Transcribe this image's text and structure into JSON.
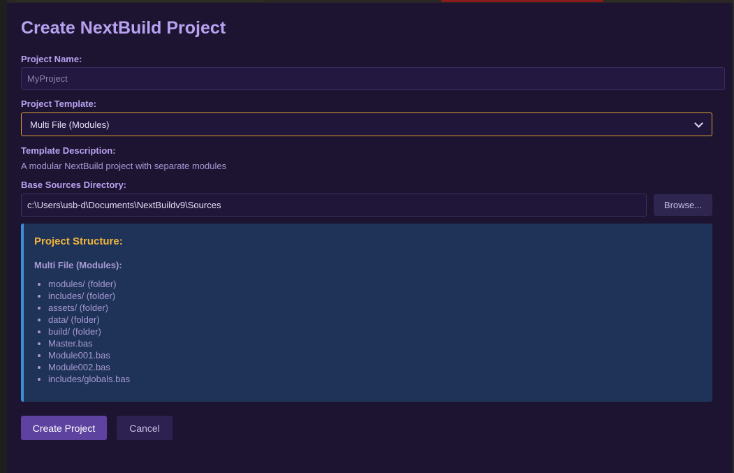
{
  "dialog": {
    "title": "Create NextBuild Project"
  },
  "project_name": {
    "label": "Project Name:",
    "placeholder": "MyProject",
    "value": ""
  },
  "project_template": {
    "label": "Project Template:",
    "selected": "Multi File (Modules)"
  },
  "template_description": {
    "label": "Template Description:",
    "text": "A modular NextBuild project with separate modules"
  },
  "base_sources": {
    "label": "Base Sources Directory:",
    "value": "c:\\Users\\usb-d\\Documents\\NextBuildv9\\Sources",
    "browse_label": "Browse..."
  },
  "structure": {
    "title": "Project Structure:",
    "subtitle": "Multi File (Modules):",
    "items": [
      "modules/ (folder)",
      "includes/ (folder)",
      "assets/ (folder)",
      "data/ (folder)",
      "build/ (folder)",
      "Master.bas",
      "Module001.bas",
      "Module002.bas",
      "includes/globals.bas"
    ]
  },
  "actions": {
    "create_label": "Create Project",
    "cancel_label": "Cancel"
  },
  "colors": {
    "background": "#1d1432",
    "heading": "#b8a2f0",
    "accent_border": "#e0a030",
    "structure_bg": "#1e3357",
    "structure_bar": "#3a8fd8",
    "structure_title": "#f1b43c",
    "primary_button": "#5d42a0"
  }
}
